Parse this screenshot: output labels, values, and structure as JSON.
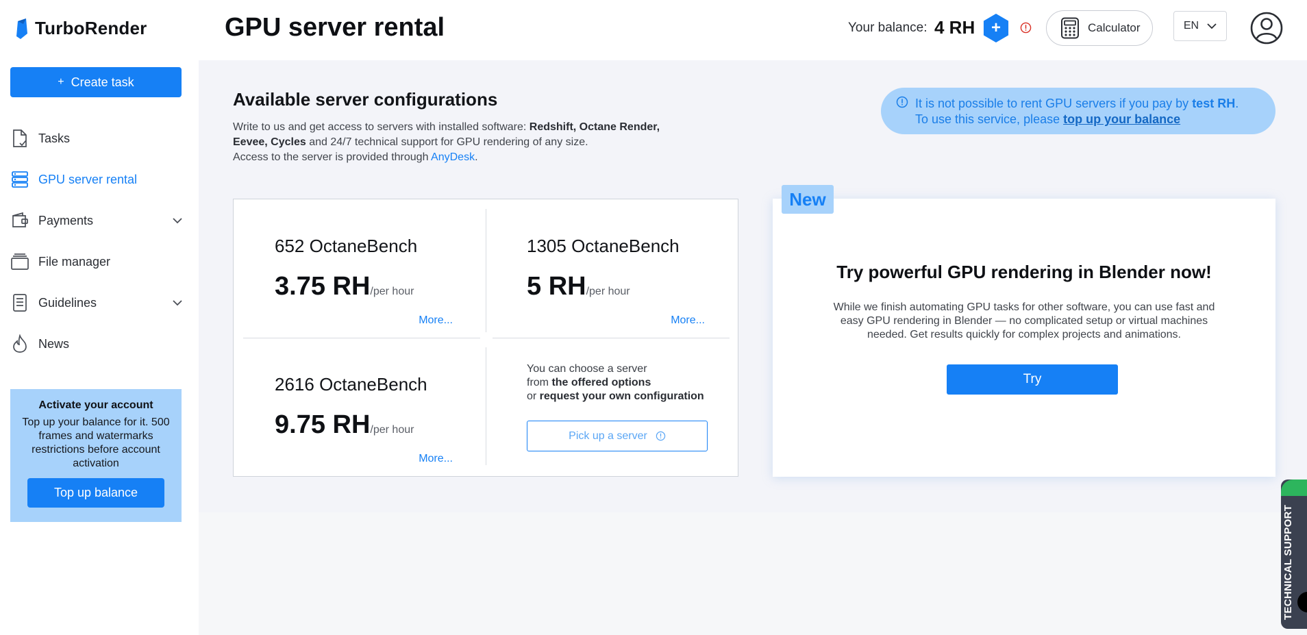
{
  "header": {
    "logo_text": "TurboRender",
    "page_title": "GPU server rental",
    "balance_label": "Your balance:",
    "balance_value": "4 RH",
    "add_balance_label": "+",
    "calculator_label": "Calculator",
    "language": "EN"
  },
  "sidebar": {
    "create_task_label": "Create task",
    "create_task_plus": "+",
    "items": [
      {
        "label": "Tasks",
        "icon": "document-icon"
      },
      {
        "label": "GPU server rental",
        "icon": "server-icon",
        "active": true
      },
      {
        "label": "Payments",
        "icon": "wallet-icon",
        "expandable": true
      },
      {
        "label": "File manager",
        "icon": "folder-stack-icon"
      },
      {
        "label": "Guidelines",
        "icon": "guidelines-icon",
        "expandable": true
      },
      {
        "label": "News",
        "icon": "flame-icon"
      }
    ],
    "activate": {
      "title": "Activate your account",
      "text": "Top up your balance for it. 500 frames and watermarks restrictions before account activation",
      "button_label": "Top up balance"
    }
  },
  "main": {
    "section_title": "Available server configurations",
    "desc_intro": "Write to us and get access to servers with installed software: ",
    "desc_software_1": "Redshift, Octane Render,",
    "desc_software_2": "Eevee, Cycles",
    "desc_support": " and 24/7 technical support for GPU rendering of any size.",
    "desc_access": "Access to the server is provided through ",
    "desc_anydesk": "AnyDesk",
    "desc_period": ".",
    "notice": {
      "text_1": "It is not possible to rent GPU servers if you pay by ",
      "text_bold": "test RH",
      "text_2": ".",
      "text_3": "To use this service, please ",
      "link": "top up your balance"
    },
    "configs": [
      {
        "bench": "652 OctaneBench",
        "price": "3.75 RH",
        "unit": "/per hour",
        "more": "More..."
      },
      {
        "bench": "1305 OctaneBench",
        "price": "5 RH",
        "unit": "/per hour",
        "more": "More..."
      },
      {
        "bench": "2616 OctaneBench",
        "price": "9.75 RH",
        "unit": "/per hour",
        "more": "More..."
      }
    ],
    "choose": {
      "line1": "You can choose a server",
      "line2_pre": "from ",
      "line2_bold": "the offered options",
      "line3_pre": "or ",
      "line3_bold": "request your own configuration",
      "button_label": "Pick up a server"
    },
    "promo": {
      "badge": "New",
      "title": "Try powerful GPU rendering in Blender now!",
      "text": "While we finish automating GPU tasks for other software, you can use fast and easy GPU rendering in Blender — no complicated setup or virtual machines needed. Get results quickly for complex projects and animations.",
      "button_label": "Try"
    }
  },
  "support_tab_label": "TECHNICAL SUPPORT",
  "colors": {
    "accent": "#1680f5",
    "light_accent": "#a7d2fb",
    "background": "#f3f4f9",
    "support_tab": "#3b4150",
    "online_indicator": "#2db55d",
    "warning_icon": "#d93025"
  }
}
